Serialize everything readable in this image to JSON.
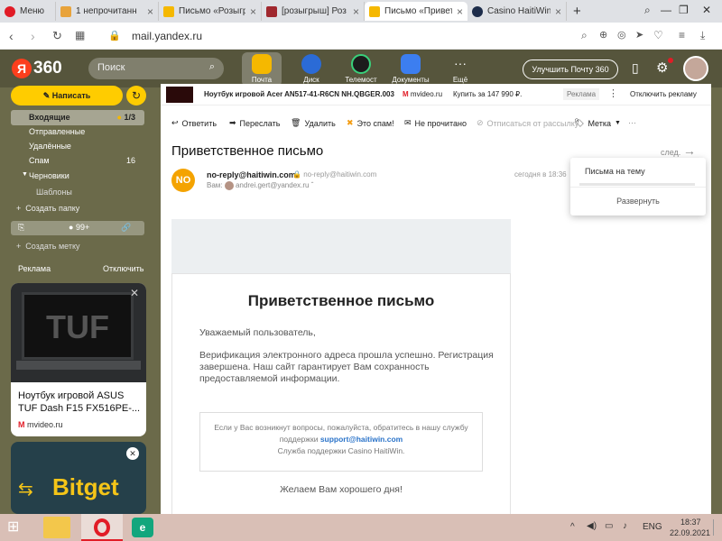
{
  "browser": {
    "menu_label": "Меню",
    "tabs": [
      {
        "title": "1 непрочитанн",
        "color": "#e8a33b"
      },
      {
        "title": "Письмо «Розыгр",
        "color": "#f5b800"
      },
      {
        "title": "[розыгрыш] Роз",
        "color": "#a0282e"
      },
      {
        "title": "Письмо «Привет",
        "color": "#f5b800",
        "active": true
      },
      {
        "title": "Casino HaitiWin",
        "color": "#1d2c4a"
      }
    ],
    "new_tab": "+",
    "url": "mail.yandex.ru"
  },
  "mail_header": {
    "logo": "360",
    "logo_ya": "Я",
    "search_placeholder": "Поиск",
    "services": [
      {
        "label": "Почта",
        "color": "#f5b800",
        "active": true
      },
      {
        "label": "Диск",
        "color": "#2b6bd6"
      },
      {
        "label": "Телемост",
        "color": "#1c1c1c"
      },
      {
        "label": "Документы",
        "color": "#3c7ef0"
      },
      {
        "label": "Ещё",
        "color": "transparent"
      }
    ],
    "upgrade_label": "Улучшить Почту 360"
  },
  "sidebar": {
    "write_label": "Написать",
    "folders": [
      {
        "label": "Входящие",
        "count": "1/3",
        "active": true
      },
      {
        "label": "Отправленные",
        "count": ""
      },
      {
        "label": "Удалённые",
        "count": ""
      },
      {
        "label": "Спам",
        "count": "16"
      },
      {
        "label": "Черновики",
        "count": ""
      }
    ],
    "templates": "Шаблоны",
    "create_folder": "Создать папку",
    "badge_count": "99+",
    "create_label": "Создать метку",
    "ads_label": "Реклама",
    "ads_off": "Отключить",
    "ad1_title": "Ноутбук игровой ASUS TUF Dash F15 FX516PE-...",
    "ad1_source": "mvideo.ru",
    "ad1_brand": "TUF",
    "ad2_brand": "Bitget"
  },
  "ad_banner": {
    "title": "Ноутбук игровой Acer AN517-41-R6CN NH.QBGER.003",
    "source": "mvideo.ru",
    "price": "Купить за 147 990 ₽.",
    "tag": "Реклама",
    "disable": "Отключить рекламу"
  },
  "toolbar": {
    "reply": "Ответить",
    "forward": "Переслать",
    "delete": "Удалить",
    "spam": "Это спам!",
    "unread": "Не прочитано",
    "unsubscribe": "Отписаться от рассылку",
    "label": "Метка"
  },
  "message": {
    "subject": "Приветственное письмо",
    "next": "след.",
    "avatar": "NO",
    "from_name": "no-reply@haitiwin.com",
    "from_addr": "no-reply@haitiwin.com",
    "date": "сегодня в 18:36",
    "to_label": "Вам:",
    "to_addr": "andrei.gert@yandex.ru",
    "body_title": "Приветственное письмо",
    "greeting": "Уважаемый пользователь,",
    "para": "Верификация электронного адреса прошла успешно. Регистрация завершена. Наш сайт гарантирует Вам сохранность предоставляемой информации.",
    "support_text": "Если у Вас возникнут вопросы, пожалуйста, обратитесь в нашу службу поддержки",
    "support_email": "support@haitiwin.com",
    "support_sign": "Служба поддержки Casino HaitiWin.",
    "closing": "Желаем Вам хорошего дня!"
  },
  "thread_popup": {
    "title": "Письма на тему",
    "expand": "Развернуть"
  },
  "taskbar": {
    "lang": "ENG",
    "time": "18:37",
    "date": "22.09.2021"
  }
}
